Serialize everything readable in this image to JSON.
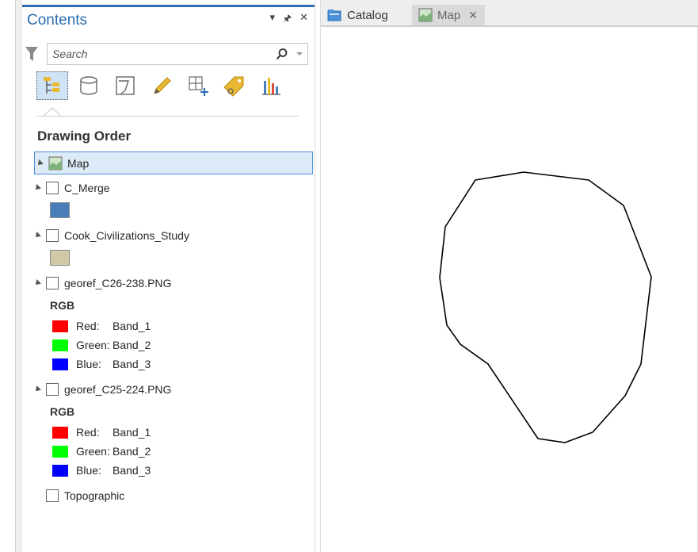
{
  "contents": {
    "title": "Contents",
    "controls": [
      "▾",
      "ᚐ",
      "✕"
    ],
    "search_placeholder": "Search",
    "section_heading": "Drawing Order",
    "toolbar": [
      {
        "name": "list-by-drawing-order",
        "active": true
      },
      {
        "name": "list-by-data-source",
        "active": false
      },
      {
        "name": "list-by-selection",
        "active": false
      },
      {
        "name": "list-by-editing",
        "active": false
      },
      {
        "name": "list-by-snapping",
        "active": false
      },
      {
        "name": "list-by-labeling",
        "active": false
      },
      {
        "name": "list-by-charts",
        "active": false
      }
    ],
    "tree": {
      "map_label": "Map",
      "layers": [
        {
          "label": "C_Merge",
          "swatch_color": "#4a7ebb"
        },
        {
          "label": "Cook_Civilizations_Study",
          "swatch_color": "#d0c9a6"
        },
        {
          "label": "georef_C26-238.PNG",
          "renderer": "RGB",
          "bands": [
            {
              "channel": "Red:",
              "band": "Band_1",
              "color": "#ff0000"
            },
            {
              "channel": "Green:",
              "band": "Band_2",
              "color": "#00ff00"
            },
            {
              "channel": "Blue:",
              "band": "Band_3",
              "color": "#0000ff"
            }
          ]
        },
        {
          "label": "georef_C25-224.PNG",
          "renderer": "RGB",
          "bands": [
            {
              "channel": "Red:",
              "band": "Band_1",
              "color": "#ff0000"
            },
            {
              "channel": "Green:",
              "band": "Band_2",
              "color": "#00ff00"
            },
            {
              "channel": "Blue:",
              "band": "Band_3",
              "color": "#0000ff"
            }
          ]
        },
        {
          "label": "Topographic"
        }
      ]
    }
  },
  "tabs": {
    "catalog": "Catalog",
    "map": "Map",
    "map_close": "✕"
  },
  "colors": {
    "accent": "#2b6cb0",
    "selection_fill": "#ddeaf7",
    "selection_border": "#4a90d9"
  }
}
